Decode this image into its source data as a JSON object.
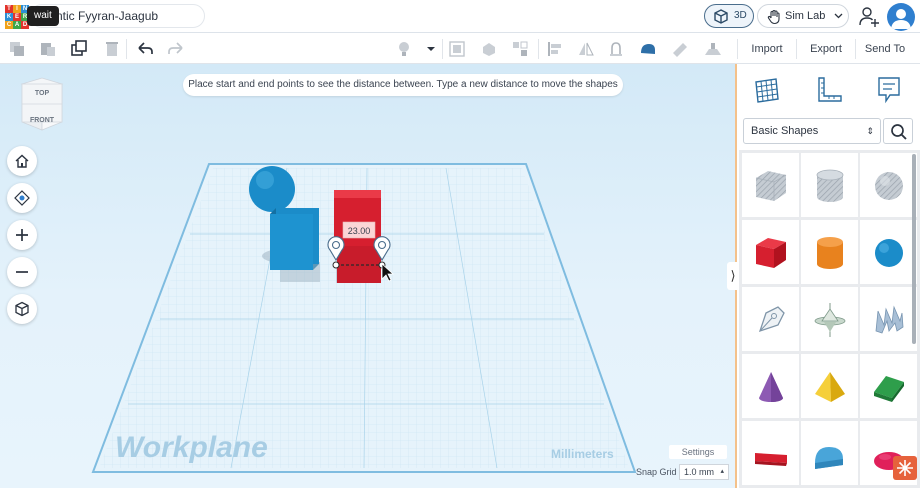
{
  "titlebar": {
    "wait_label": "wait",
    "design_title": "ntic Fyyran-Jaagub",
    "view_3d_label": "3D",
    "simlab_label": "Sim Lab"
  },
  "toolbar": {
    "import_label": "Import",
    "export_label": "Export",
    "send_to_label": "Send To"
  },
  "workspace": {
    "hint_text": "Place start and end points to see the distance between. Type a new distance to move the shapes",
    "viewcube_top": "TOP",
    "viewcube_front": "FRONT",
    "workplane_label": "Workplane",
    "units_label": "Millimeters",
    "measure_value": "23.00",
    "settings_label": "Settings",
    "snap_grid_label": "Snap Grid",
    "snap_grid_value": "1.0 mm",
    "snap_caret": "▴"
  },
  "panel": {
    "dropdown_value": "Basic Shapes",
    "dropdown_caret": "⇕",
    "collapse_glyph": "⟩",
    "shapes": [
      {
        "name": "box-hole",
        "color": "#b9c1c9"
      },
      {
        "name": "cylinder-hole",
        "color": "#b9c1c9"
      },
      {
        "name": "sphere-hole",
        "color": "#b9c1c9"
      },
      {
        "name": "box",
        "color": "#d61f2f"
      },
      {
        "name": "cylinder",
        "color": "#e8821e"
      },
      {
        "name": "sphere",
        "color": "#1b8cc9"
      },
      {
        "name": "scribble",
        "color": "#9fb0be"
      },
      {
        "name": "shape-generator",
        "color": "#9fb8a8"
      },
      {
        "name": "text-shape",
        "color": "#8ea9c6"
      },
      {
        "name": "cone",
        "color": "#8d5ab3"
      },
      {
        "name": "pyramid",
        "color": "#f2c21b"
      },
      {
        "name": "roof",
        "color": "#2e9e4b"
      },
      {
        "name": "text",
        "color": "#d61f2f"
      },
      {
        "name": "half-cylinder",
        "color": "#49a5d9"
      },
      {
        "name": "paraboloid",
        "color": "#e0205a"
      }
    ]
  },
  "colors": {
    "accent": "#2f7fcf",
    "workplane_line": "#9ccbe6",
    "selection_red": "#d61f2f",
    "shape_blue": "#1b8cc9"
  }
}
